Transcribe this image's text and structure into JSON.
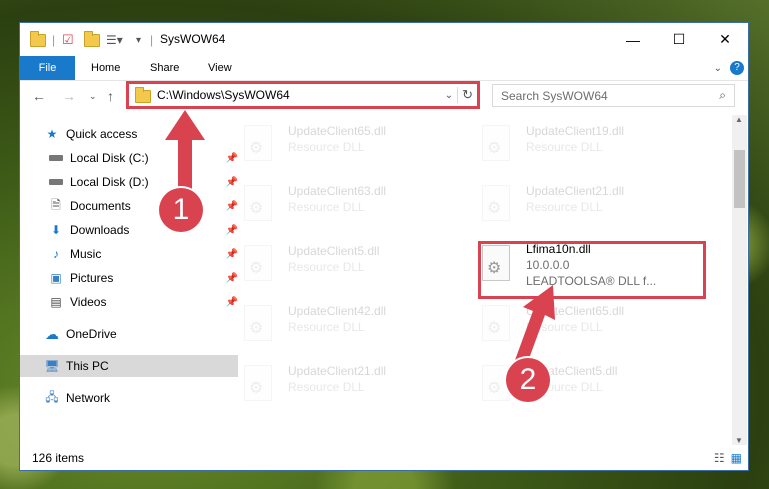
{
  "window": {
    "title": "SysWOW64"
  },
  "ribbon": {
    "tabs": [
      "File",
      "Home",
      "Share",
      "View"
    ]
  },
  "address": {
    "path": "C:\\Windows\\SysWOW64"
  },
  "search": {
    "placeholder": "Search SysWOW64"
  },
  "sidebar": {
    "items": [
      {
        "label": "Quick access",
        "icon": "star-icon"
      },
      {
        "label": "Local Disk (C:)",
        "icon": "drive-icon"
      },
      {
        "label": "Local Disk (D:)",
        "icon": "drive-icon"
      },
      {
        "label": "Documents",
        "icon": "documents-icon"
      },
      {
        "label": "Downloads",
        "icon": "download-icon"
      },
      {
        "label": "Music",
        "icon": "music-icon"
      },
      {
        "label": "Pictures",
        "icon": "pictures-icon"
      },
      {
        "label": "Videos",
        "icon": "videos-icon"
      },
      {
        "label": "OneDrive",
        "icon": "cloud-icon"
      },
      {
        "label": "This PC",
        "icon": "computer-icon"
      },
      {
        "label": "Network",
        "icon": "network-icon"
      }
    ]
  },
  "files": [
    {
      "name": "UpdateClient65.dll",
      "desc": "Resource DLL"
    },
    {
      "name": "UpdateClient19.dll",
      "desc": "Resource DLL"
    },
    {
      "name": "UpdateClient63.dll",
      "desc": "Resource DLL"
    },
    {
      "name": "UpdateClient21.dll",
      "desc": "Resource DLL"
    },
    {
      "name": "UpdateClient5.dll",
      "desc": "Resource DLL"
    },
    {
      "name": "Lfima10n.dll",
      "desc": "10.0.0.0",
      "desc2": "LEADTOOLSA® DLL f..."
    },
    {
      "name": "UpdateClient42.dll",
      "desc": "Resource DLL"
    },
    {
      "name": "UpdateClient65.dll",
      "desc": "Resource DLL"
    },
    {
      "name": "UpdateClient21.dll",
      "desc": "Resource DLL"
    },
    {
      "name": "UpdateClient5.dll",
      "desc": "Resource DLL"
    }
  ],
  "status": {
    "count": "126 items"
  },
  "annotations": {
    "step1": "1",
    "step2": "2"
  },
  "colors": {
    "accent": "#1979ca",
    "highlight": "#d9434f"
  }
}
